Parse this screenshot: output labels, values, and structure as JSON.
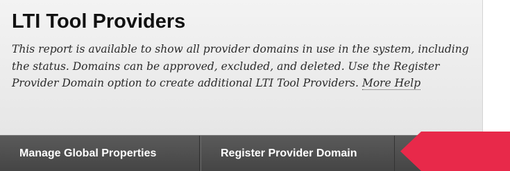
{
  "header": {
    "title": "LTI Tool Providers",
    "description_text": "This report is available to show all provider domains in use in the system, including the status. Domains can be approved, excluded, and deleted. Use the Register Provider Domain option to create additional LTI Tool Providers. ",
    "more_help_label": "More Help"
  },
  "action_bar": {
    "buttons": [
      {
        "label": "Manage Global Properties"
      },
      {
        "label": "Register Provider Domain"
      }
    ]
  },
  "annotation": {
    "icon": "arrow-pointer-icon",
    "color": "#e8294a"
  },
  "colors": {
    "action_bar_bg": "#4f4f4f",
    "header_bg": "#ececec",
    "title_text": "#111111"
  }
}
